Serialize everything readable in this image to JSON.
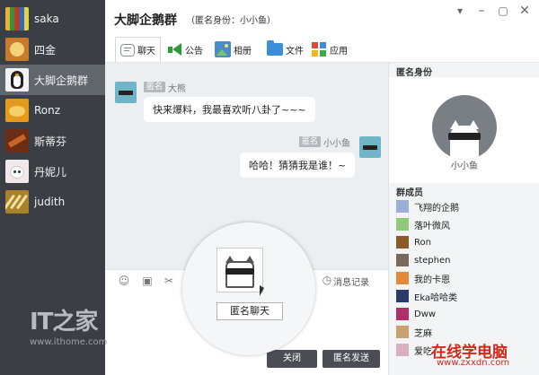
{
  "sidebar": {
    "contacts": [
      {
        "name": "saka"
      },
      {
        "name": "四金"
      },
      {
        "name": "大脚企鹅群"
      },
      {
        "name": "Ronz"
      },
      {
        "name": "斯蒂芬"
      },
      {
        "name": "丹妮儿"
      },
      {
        "name": "judith"
      }
    ],
    "active_index": 2
  },
  "header": {
    "title": "大脚企鹅群",
    "anon_identity": "（匿名身份：小小鱼）",
    "tabs": [
      {
        "label": "聊天",
        "icon": "chat-icon"
      },
      {
        "label": "公告",
        "icon": "megaphone-icon"
      },
      {
        "label": "相册",
        "icon": "photo-icon"
      },
      {
        "label": "文件",
        "icon": "folder-icon"
      },
      {
        "label": "应用",
        "icon": "apps-icon"
      }
    ]
  },
  "chat": {
    "messages": [
      {
        "badge": "匿名",
        "sender": "大熊",
        "text": "快来爆料，我最喜欢听八卦了~~~",
        "side": "left"
      },
      {
        "badge": "匿名",
        "sender": "小小鱼",
        "text": "哈哈！猜猜我是谁！~",
        "side": "right"
      }
    ]
  },
  "toolbar": {
    "history_label": "消息记录"
  },
  "magnifier": {
    "anon_chat_label": "匿名聊天"
  },
  "buttons": {
    "close": "关闭",
    "anon_send": "匿名发送"
  },
  "right_panel": {
    "identity_title": "匿名身份",
    "identity_name": "小小鱼",
    "members_title": "群成员",
    "members": [
      {
        "name": "飞翔的企鹅",
        "color": "#9ab0d8"
      },
      {
        "name": "落叶微风",
        "color": "#8fc97a"
      },
      {
        "name": "Ron",
        "color": "#8a5a2b"
      },
      {
        "name": "stephen",
        "color": "#7a6a5a"
      },
      {
        "name": "我的卡恩",
        "color": "#e38a3a"
      },
      {
        "name": "Eka哈哈类",
        "color": "#2a3a6a"
      },
      {
        "name": "Dww",
        "color": "#b0306a"
      },
      {
        "name": "芝麻",
        "color": "#c9a070"
      },
      {
        "name": "爱吃",
        "color": "#d9b0c0"
      }
    ]
  },
  "watermarks": {
    "logo": "IT之家",
    "url": "www.ithome.com",
    "site_title": "在线学电脑",
    "site_url": "www.zxxdn.com"
  }
}
